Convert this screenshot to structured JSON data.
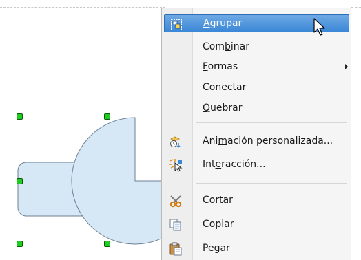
{
  "colors": {
    "shape_fill": "#d6e8f5",
    "shape_stroke": "#6a7f95",
    "handle": "#22cc22",
    "highlight": "#3a87d6"
  },
  "menu": {
    "items": [
      {
        "label_pre": "",
        "accel": "A",
        "label_post": "grupar",
        "icon": "group-icon",
        "highlighted": true
      },
      {
        "label_pre": "Com",
        "accel": "b",
        "label_post": "inar",
        "icon": "",
        "highlighted": false
      },
      {
        "label_pre": "",
        "accel": "F",
        "label_post": "ormas",
        "icon": "",
        "submenu": true
      },
      {
        "label_pre": "C",
        "accel": "o",
        "label_post": "nectar",
        "icon": ""
      },
      {
        "label_pre": "",
        "accel": "Q",
        "label_post": "uebrar",
        "icon": ""
      },
      {
        "label_pre": "Ani",
        "accel": "m",
        "label_post": "ación personalizada...",
        "icon": "custom-animation-icon"
      },
      {
        "label_pre": "Int",
        "accel": "e",
        "label_post": "racción...",
        "icon": "interaction-icon"
      },
      {
        "label_pre": "C",
        "accel": "o",
        "label_post": "rtar",
        "icon": "scissors-icon"
      },
      {
        "label_pre": "",
        "accel": "C",
        "label_post": "opiar",
        "icon": "copy-icon"
      },
      {
        "label_pre": "",
        "accel": "P",
        "label_post": "egar",
        "icon": "paste-icon"
      }
    ]
  }
}
